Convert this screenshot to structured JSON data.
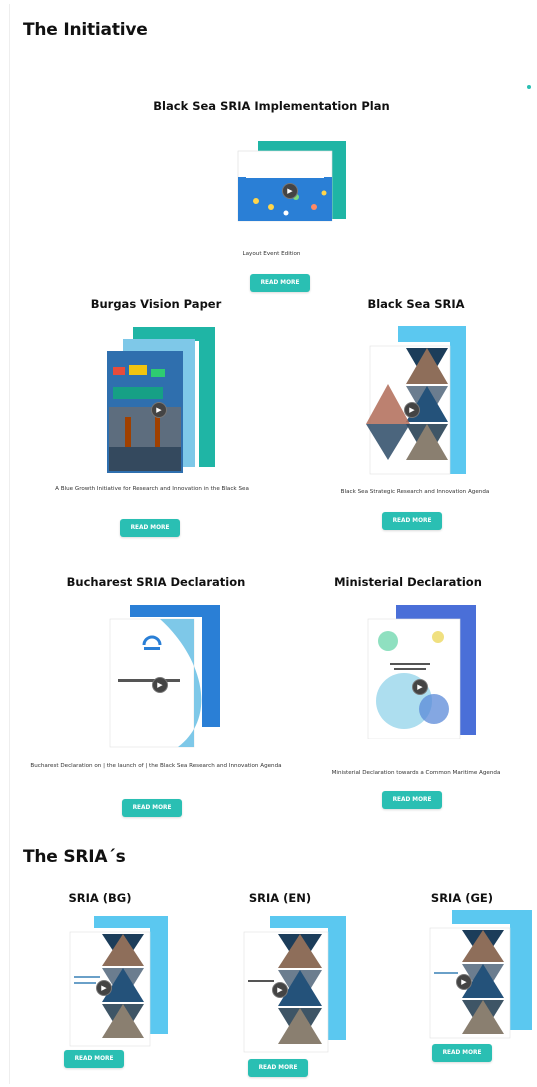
{
  "initiative": {
    "heading": "The Initiative",
    "featured": {
      "title": "Black Sea SRIA Implementation Plan",
      "caption": "Layout Event Edition",
      "button": "READ MORE"
    },
    "docs": [
      {
        "title": "Burgas Vision Paper",
        "caption": "A Blue Growth Initiative for Research and Innovation in the Black Sea",
        "button": "READ MORE"
      },
      {
        "title": "Black Sea SRIA",
        "caption": "Black Sea Strategic Research and Innovation Agenda",
        "button": "READ MORE"
      },
      {
        "title": "Bucharest SRIA Declaration",
        "caption": "Bucharest Declaration on | the launch of | the Black Sea Research and Innovation Agenda",
        "button": "READ MORE"
      },
      {
        "title": "Ministerial Declaration",
        "caption": "Ministerial Declaration towards a Common Maritime Agenda",
        "button": "READ MORE"
      }
    ]
  },
  "srias": {
    "heading": "The SRIA´s",
    "items": [
      {
        "title": "SRIA (BG)",
        "button": "READ MORE"
      },
      {
        "title": "SRIA (EN)",
        "button": "READ MORE"
      },
      {
        "title": "SRIA (GE)",
        "button": "READ MORE"
      }
    ]
  },
  "colors": {
    "accent": "#2abfb3",
    "teal": "#1fb5a5",
    "sky": "#5bc8f0",
    "blue": "#2a7fd6",
    "indigo": "#4a6fd8"
  },
  "icons": {
    "play": "▶"
  }
}
